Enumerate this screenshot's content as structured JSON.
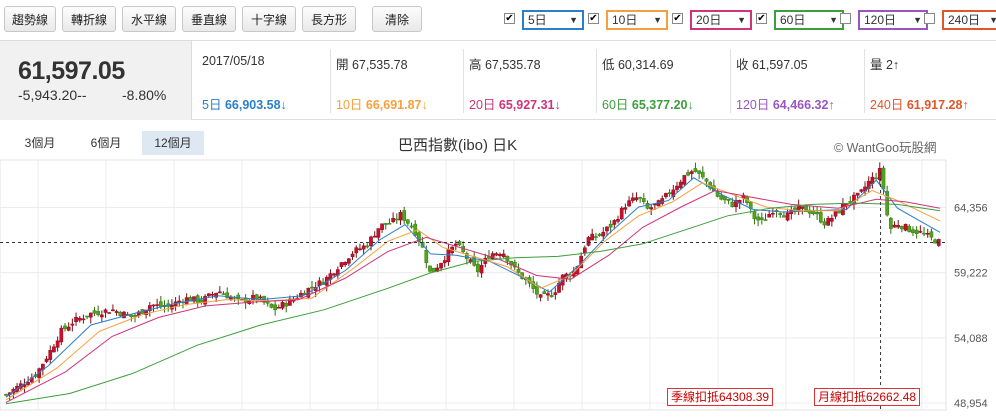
{
  "toolbar": {
    "buttons": [
      "趨勢線",
      "轉折線",
      "水平線",
      "垂直線",
      "十字線",
      "長方形"
    ],
    "clear": "清除"
  },
  "ma_selectors": [
    {
      "label": "5日",
      "checked": true,
      "color": "#2b7fc9"
    },
    {
      "label": "10日",
      "checked": true,
      "color": "#f5a03c"
    },
    {
      "label": "20日",
      "checked": true,
      "color": "#d0337a"
    },
    {
      "label": "60日",
      "checked": true,
      "color": "#3c9e3c"
    },
    {
      "label": "120日",
      "checked": false,
      "color": "#9a56c0"
    },
    {
      "label": "240日",
      "checked": false,
      "color": "#e0562a"
    }
  ],
  "quote": {
    "price": "61,597.05",
    "change": "-5,943.20--",
    "percent": "-8.80%",
    "date": "2017/05/18",
    "open": "開 67,535.78",
    "high": "高 67,535.78",
    "low": "低 60,314.69",
    "close": "收 61,597.05",
    "volume": "量 2↑",
    "ma5": {
      "label": "5日",
      "value": "66,903.58↓",
      "color": "#2b7fc9"
    },
    "ma10": {
      "label": "10日",
      "value": "66,691.87↓",
      "color": "#f5a03c"
    },
    "ma20": {
      "label": "20日",
      "value": "65,927.31↓",
      "color": "#d0337a"
    },
    "ma60": {
      "label": "60日",
      "value": "65,377.20↓",
      "color": "#3c9e3c"
    },
    "ma120": {
      "label": "120日",
      "value": "64,466.32↑",
      "color": "#9a56c0"
    },
    "ma240": {
      "label": "240日",
      "value": "61,917.28↑",
      "color": "#e0562a"
    }
  },
  "ranges": [
    {
      "label": "3個月",
      "active": false
    },
    {
      "label": "6個月",
      "active": false
    },
    {
      "label": "12個月",
      "active": true
    }
  ],
  "chart_data": {
    "type": "candlestick",
    "title": "巴西指數(ibo) 日K",
    "watermark": "© WantGoo玩股網",
    "y_ticks": [
      64356,
      59222,
      54088,
      48954
    ],
    "y_tick_labels": [
      "64,356",
      "59,222",
      "54,088",
      "48,954"
    ],
    "ylim": [
      48400,
      68100
    ],
    "current_level": 61597,
    "markers": [
      {
        "label": "季線扣抵64308.39"
      },
      {
        "label": "月線扣抵62662.48"
      }
    ],
    "close_path": [
      [
        0,
        49600
      ],
      [
        8,
        50500
      ],
      [
        14,
        51200
      ],
      [
        20,
        52800
      ],
      [
        26,
        54600
      ],
      [
        32,
        55400
      ],
      [
        40,
        56000
      ],
      [
        50,
        56300
      ],
      [
        60,
        55700
      ],
      [
        68,
        56700
      ],
      [
        76,
        56500
      ],
      [
        84,
        57200
      ],
      [
        92,
        57000
      ],
      [
        100,
        57800
      ],
      [
        110,
        56900
      ],
      [
        118,
        57300
      ],
      [
        126,
        56300
      ],
      [
        134,
        57000
      ],
      [
        142,
        57900
      ],
      [
        150,
        58600
      ],
      [
        158,
        60000
      ],
      [
        164,
        60900
      ],
      [
        170,
        61400
      ],
      [
        176,
        62900
      ],
      [
        182,
        63200
      ],
      [
        186,
        63800
      ],
      [
        192,
        62700
      ],
      [
        196,
        61300
      ],
      [
        200,
        59100
      ],
      [
        206,
        60300
      ],
      [
        212,
        61500
      ],
      [
        218,
        60200
      ],
      [
        222,
        59300
      ],
      [
        228,
        60700
      ],
      [
        234,
        60900
      ],
      [
        240,
        59400
      ],
      [
        246,
        58400
      ],
      [
        252,
        57200
      ],
      [
        258,
        57600
      ],
      [
        262,
        58900
      ],
      [
        268,
        59300
      ],
      [
        274,
        61900
      ],
      [
        280,
        62200
      ],
      [
        286,
        63100
      ],
      [
        292,
        64600
      ],
      [
        298,
        65200
      ],
      [
        302,
        64200
      ],
      [
        308,
        64700
      ],
      [
        314,
        65800
      ],
      [
        320,
        66900
      ],
      [
        324,
        67300
      ],
      [
        330,
        66400
      ],
      [
        336,
        65100
      ],
      [
        342,
        64600
      ],
      [
        348,
        65200
      ],
      [
        352,
        63600
      ],
      [
        356,
        63200
      ],
      [
        362,
        64300
      ],
      [
        368,
        63700
      ],
      [
        374,
        64300
      ],
      [
        380,
        64000
      ],
      [
        386,
        63100
      ],
      [
        392,
        64000
      ],
      [
        396,
        64800
      ],
      [
        402,
        65300
      ],
      [
        406,
        66300
      ],
      [
        410,
        66900
      ],
      [
        412,
        67300
      ],
      [
        414,
        65200
      ],
      [
        416,
        62600
      ],
      [
        420,
        63100
      ],
      [
        426,
        62600
      ],
      [
        432,
        62300
      ],
      [
        436,
        61900
      ],
      [
        440,
        61600
      ]
    ],
    "ma_paths": [
      {
        "name": "5日",
        "color": "#2b7fc9",
        "points": [
          [
            0,
            49400
          ],
          [
            20,
            51900
          ],
          [
            40,
            55100
          ],
          [
            60,
            56000
          ],
          [
            80,
            56800
          ],
          [
            100,
            57400
          ],
          [
            120,
            57100
          ],
          [
            140,
            57400
          ],
          [
            160,
            59400
          ],
          [
            176,
            61800
          ],
          [
            188,
            63000
          ],
          [
            200,
            60700
          ],
          [
            212,
            60600
          ],
          [
            228,
            60100
          ],
          [
            244,
            58800
          ],
          [
            256,
            57700
          ],
          [
            270,
            59800
          ],
          [
            284,
            62300
          ],
          [
            298,
            64400
          ],
          [
            312,
            64900
          ],
          [
            324,
            66700
          ],
          [
            338,
            65300
          ],
          [
            352,
            64200
          ],
          [
            366,
            64000
          ],
          [
            380,
            64100
          ],
          [
            396,
            64200
          ],
          [
            410,
            66500
          ],
          [
            420,
            64300
          ],
          [
            440,
            62400
          ]
        ]
      },
      {
        "name": "10日",
        "color": "#f5a03c",
        "points": [
          [
            0,
            49200
          ],
          [
            24,
            51700
          ],
          [
            44,
            54600
          ],
          [
            64,
            55900
          ],
          [
            84,
            56700
          ],
          [
            104,
            57100
          ],
          [
            124,
            57000
          ],
          [
            144,
            57200
          ],
          [
            164,
            59600
          ],
          [
            180,
            61700
          ],
          [
            194,
            62600
          ],
          [
            206,
            61200
          ],
          [
            220,
            60500
          ],
          [
            236,
            59700
          ],
          [
            252,
            58000
          ],
          [
            266,
            59000
          ],
          [
            282,
            61700
          ],
          [
            298,
            63700
          ],
          [
            314,
            64800
          ],
          [
            328,
            66300
          ],
          [
            342,
            65400
          ],
          [
            358,
            64400
          ],
          [
            374,
            64100
          ],
          [
            392,
            64100
          ],
          [
            408,
            65700
          ],
          [
            420,
            64900
          ],
          [
            440,
            63300
          ]
        ]
      },
      {
        "name": "20日",
        "color": "#d0337a",
        "points": [
          [
            0,
            49000
          ],
          [
            28,
            51400
          ],
          [
            50,
            54200
          ],
          [
            72,
            55700
          ],
          [
            94,
            56600
          ],
          [
            116,
            56900
          ],
          [
            138,
            57100
          ],
          [
            160,
            58800
          ],
          [
            180,
            60900
          ],
          [
            198,
            62000
          ],
          [
            214,
            61200
          ],
          [
            232,
            60300
          ],
          [
            250,
            59000
          ],
          [
            266,
            58700
          ],
          [
            284,
            60600
          ],
          [
            300,
            62800
          ],
          [
            318,
            64400
          ],
          [
            334,
            65700
          ],
          [
            350,
            65200
          ],
          [
            370,
            64600
          ],
          [
            392,
            64300
          ],
          [
            410,
            65000
          ],
          [
            424,
            64800
          ],
          [
            440,
            64300
          ]
        ]
      },
      {
        "name": "60日",
        "color": "#3c9e3c",
        "points": [
          [
            0,
            48900
          ],
          [
            30,
            49700
          ],
          [
            60,
            51300
          ],
          [
            90,
            53500
          ],
          [
            120,
            55100
          ],
          [
            150,
            56300
          ],
          [
            180,
            58000
          ],
          [
            200,
            59200
          ],
          [
            220,
            60100
          ],
          [
            240,
            60400
          ],
          [
            260,
            60500
          ],
          [
            280,
            60900
          ],
          [
            300,
            61500
          ],
          [
            320,
            62600
          ],
          [
            340,
            63700
          ],
          [
            360,
            64300
          ],
          [
            380,
            64600
          ],
          [
            400,
            64700
          ],
          [
            420,
            64600
          ],
          [
            440,
            64100
          ]
        ]
      }
    ]
  }
}
